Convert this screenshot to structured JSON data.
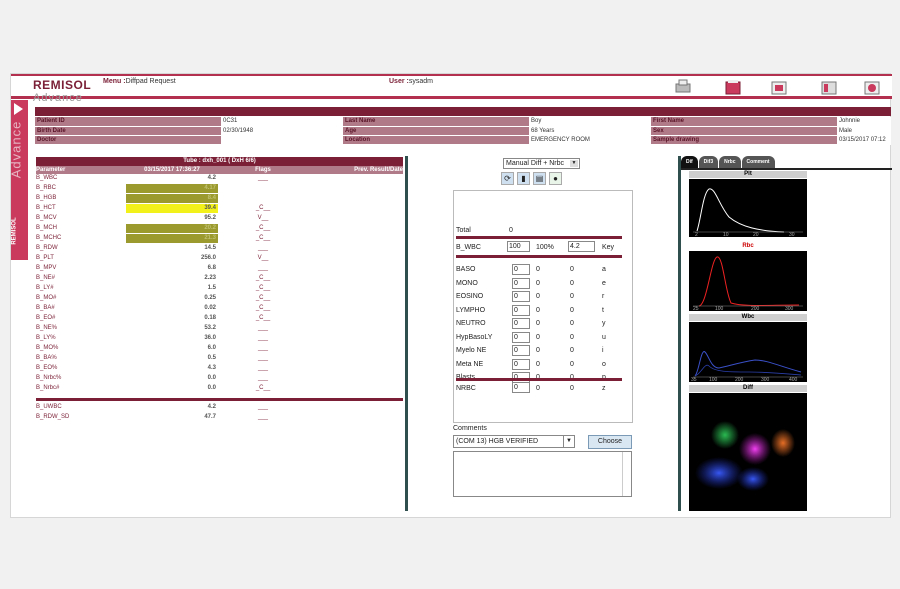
{
  "app": {
    "logo_line1": "REMISOL",
    "logo_line2": "Advance",
    "menu_label": "Menu :",
    "menu_value": "Diffpad Request",
    "user_label": "User :",
    "user_value": "sysadm",
    "side_text": "Advance",
    "side_brand": "REMISOL"
  },
  "toolbar": {
    "icons": [
      "print-icon",
      "book-icon",
      "export-icon",
      "archive-icon",
      "patient-icon"
    ]
  },
  "patient": {
    "row1": [
      "Patient ID",
      "0C31",
      "Last Name",
      "Boy",
      "First Name",
      "Johnnie"
    ],
    "row2": [
      "Birth Date",
      "02/30/1948",
      "Age",
      "68 Years",
      "Sex",
      "Male"
    ],
    "row3": [
      "Doctor",
      "",
      "Location",
      "EMERGENCY ROOM",
      "Sample drawing",
      "03/15/2017 07:12"
    ]
  },
  "results": {
    "tube": "Tube : dxh_001 ( DxH 6/6)",
    "headers": [
      "Parameter",
      "03/15/2017 17:36:27",
      "Flags",
      "Prev. Result/Date"
    ],
    "rows": [
      {
        "p": "B_WBC",
        "v": "4.2",
        "f": "___",
        "hl": ""
      },
      {
        "p": "B_RBC",
        "v": "4.17",
        "f": "",
        "hl": "o"
      },
      {
        "p": "B_HGB",
        "v": "8.4",
        "f": "",
        "hl": "o"
      },
      {
        "p": "B_HCT",
        "v": "39.4",
        "f": "_C__",
        "hl": "y"
      },
      {
        "p": "B_MCV",
        "v": "95.2",
        "f": "V__",
        "hl": ""
      },
      {
        "p": "B_MCH",
        "v": "20.2",
        "f": "_C__",
        "hl": "o"
      },
      {
        "p": "B_MCHC",
        "v": "21.3",
        "f": "_C__",
        "hl": "o"
      },
      {
        "p": "B_RDW",
        "v": "14.5",
        "f": "___",
        "hl": ""
      },
      {
        "p": "B_PLT",
        "v": "256.0",
        "f": "V__",
        "hl": ""
      },
      {
        "p": "B_MPV",
        "v": "6.8",
        "f": "___",
        "hl": ""
      },
      {
        "p": "B_NE#",
        "v": "2.23",
        "f": "_C__",
        "hl": ""
      },
      {
        "p": "B_LY#",
        "v": "1.5",
        "f": "_C__",
        "hl": ""
      },
      {
        "p": "B_MO#",
        "v": "0.25",
        "f": "_C__",
        "hl": ""
      },
      {
        "p": "B_BA#",
        "v": "0.02",
        "f": "_C__",
        "hl": ""
      },
      {
        "p": "B_EO#",
        "v": "0.18",
        "f": "_C__",
        "hl": ""
      },
      {
        "p": "B_NE%",
        "v": "53.2",
        "f": "___",
        "hl": ""
      },
      {
        "p": "B_LY%",
        "v": "36.0",
        "f": "___",
        "hl": ""
      },
      {
        "p": "B_MO%",
        "v": "6.0",
        "f": "___",
        "hl": ""
      },
      {
        "p": "B_BA%",
        "v": "0.5",
        "f": "___",
        "hl": ""
      },
      {
        "p": "B_EO%",
        "v": "4.3",
        "f": "___",
        "hl": ""
      },
      {
        "p": "B_Nrbc%",
        "v": "0.0",
        "f": "___",
        "hl": ""
      },
      {
        "p": "B_Nrbc#",
        "v": "0.0",
        "f": "_C__",
        "hl": ""
      }
    ],
    "extra": [
      {
        "p": "B_UWBC",
        "v": "4.2",
        "f": "___"
      },
      {
        "p": "B_RDW_SD",
        "v": "47.7",
        "f": "___"
      }
    ]
  },
  "diff": {
    "mode": "Manual Diff + Nrbc",
    "total_label": "Total",
    "total_value": "0",
    "wbc_label": "B_WBC",
    "wbc_value": "100",
    "wbc_pct": "100%",
    "wbc_count": "4.2",
    "key_label": "Key",
    "cells": [
      {
        "name": "BASO",
        "a": "0",
        "b": "0",
        "c": "0",
        "key": "a"
      },
      {
        "name": "MONO",
        "a": "0",
        "b": "0",
        "c": "0",
        "key": "e"
      },
      {
        "name": "EOSINO",
        "a": "0",
        "b": "0",
        "c": "0",
        "key": "r"
      },
      {
        "name": "LYMPHO",
        "a": "0",
        "b": "0",
        "c": "0",
        "key": "t"
      },
      {
        "name": "NEUTRO",
        "a": "0",
        "b": "0",
        "c": "0",
        "key": "y"
      },
      {
        "name": "HypBasoLY",
        "a": "0",
        "b": "0",
        "c": "0",
        "key": "u"
      },
      {
        "name": "Myelo NE",
        "a": "0",
        "b": "0",
        "c": "0",
        "key": "i"
      },
      {
        "name": "Meta NE",
        "a": "0",
        "b": "0",
        "c": "0",
        "key": "o"
      },
      {
        "name": "Blasts",
        "a": "0",
        "b": "0",
        "c": "0",
        "key": "p"
      }
    ],
    "nrbc": {
      "name": "NRBC",
      "a": "0",
      "b": "0",
      "c": "0",
      "key": "z"
    },
    "comments_label": "Comments",
    "comment_value": "(COM 13) HGB VERIFIED",
    "choose_label": "Choose"
  },
  "plots": {
    "tabs": [
      "Dif",
      "Dif3",
      "Nrbc",
      "Comment"
    ],
    "plt": {
      "title": "Plt",
      "ticks": [
        "2",
        "10",
        "20",
        "30"
      ]
    },
    "rbc": {
      "title": "Rbc",
      "ticks": [
        "25",
        "100",
        "200",
        "300"
      ]
    },
    "wbc": {
      "title": "Wbc",
      "ticks": [
        "35",
        "100",
        "200",
        "300",
        "400"
      ]
    },
    "diff": {
      "title": "Diff"
    }
  },
  "colors": {
    "brand": "#b3304f",
    "dark": "#7a1f36",
    "highlight_yellow": "#f2f21a",
    "highlight_olive": "#9a9a2e"
  }
}
